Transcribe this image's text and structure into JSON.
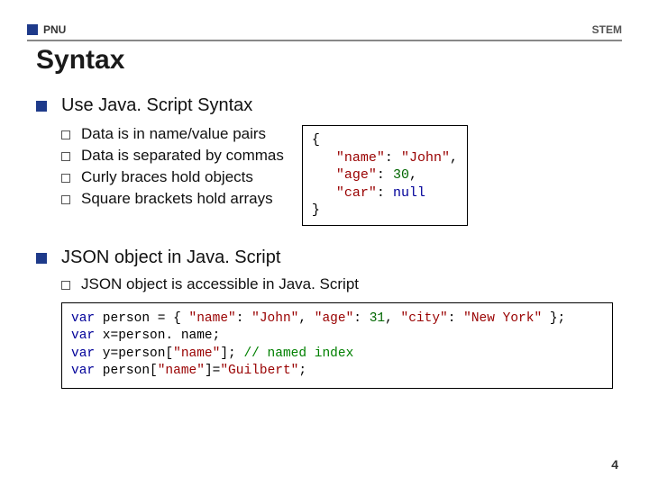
{
  "header": {
    "org": "PNU",
    "dept": "STEM"
  },
  "title": "Syntax",
  "section1": {
    "heading": "Use Java. Script Syntax",
    "bullets": [
      "Data is in name/value pairs",
      "Data is separated by commas",
      "Curly braces hold objects",
      "Square brackets hold arrays"
    ],
    "code": {
      "l1": "{",
      "l2a": "   ",
      "l2b": "\"name\"",
      "l2c": ": ",
      "l2d": "\"John\"",
      "l2e": ",",
      "l3a": "   ",
      "l3b": "\"age\"",
      "l3c": ": ",
      "l3d": "30",
      "l3e": ",",
      "l4a": "   ",
      "l4b": "\"car\"",
      "l4c": ": ",
      "l4d": "null",
      "l5": "}"
    }
  },
  "section2": {
    "heading": "JSON object in Java. Script",
    "bullets": [
      "JSON object is accessible in Java. Script"
    ],
    "code": {
      "a1": "var",
      "a2": " person = { ",
      "a3": "\"name\"",
      "a4": ": ",
      "a5": "\"John\"",
      "a6": ", ",
      "a7": "\"age\"",
      "a8": ": ",
      "a9": "31",
      "a10": ", ",
      "a11": "\"city\"",
      "a12": ": ",
      "a13": "\"New York\"",
      "a14": " };",
      "b1": "var",
      "b2": " x=person. name;",
      "c1": "var",
      "c2": " y=person[",
      "c3": "\"name\"",
      "c4": "]; ",
      "c5": "// named index",
      "d1": "var",
      "d2": " person[",
      "d3": "\"name\"",
      "d4": "]=",
      "d5": "\"Guilbert\"",
      "d6": ";"
    }
  },
  "page_number": "4"
}
